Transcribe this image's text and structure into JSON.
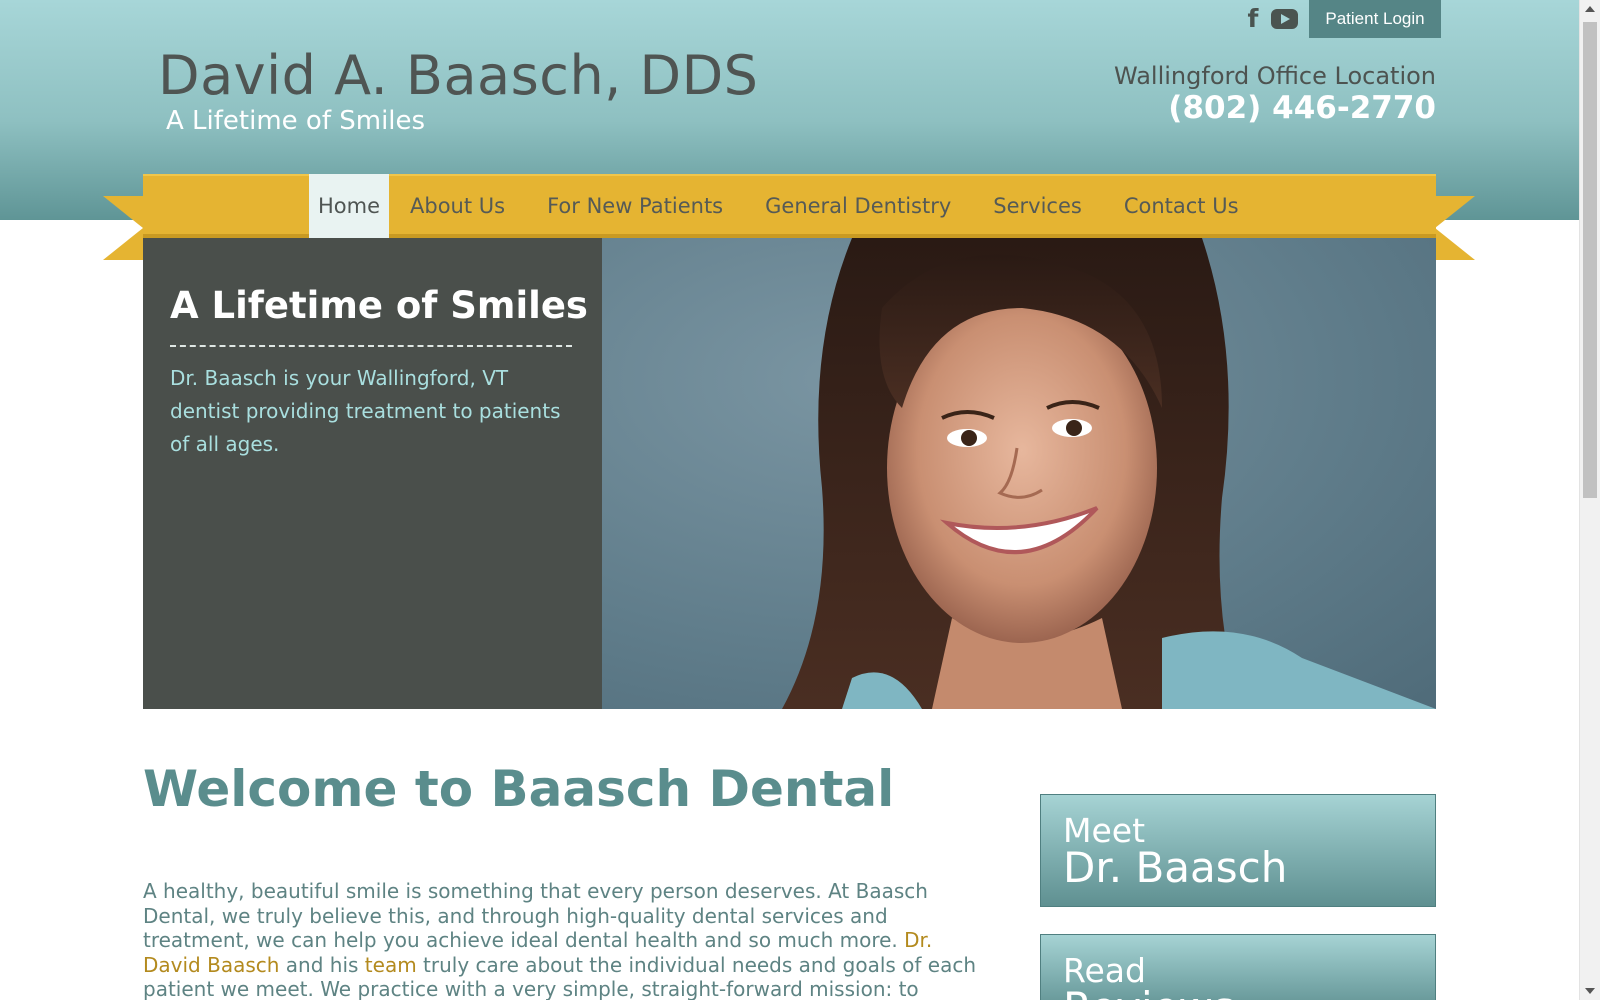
{
  "header": {
    "site_title": "David A. Baasch, DDS",
    "tagline": "A Lifetime of Smiles",
    "office_location": "Wallingford Office Location",
    "phone": "(802) 446-2770",
    "patient_login": "Patient Login",
    "social": [
      "facebook-icon",
      "youtube-icon"
    ],
    "facebook_glyph": "f"
  },
  "nav": {
    "items": [
      {
        "label": "Home",
        "active": true
      },
      {
        "label": "About Us"
      },
      {
        "label": "For New Patients"
      },
      {
        "label": "General Dentistry"
      },
      {
        "label": "Services"
      },
      {
        "label": "Contact Us"
      }
    ]
  },
  "hero": {
    "title": "A Lifetime of Smiles",
    "text": "Dr. Baasch is your Wallingford, VT dentist providing treatment to patients of all ages."
  },
  "main": {
    "welcome_title": "Welcome to Baasch Dental",
    "intro": {
      "p1": "A healthy, beautiful smile is something that every person deserves. At Baasch Dental, we truly believe this, and through high-quality dental services and treatment, we can help you achieve ideal dental health and so much more. ",
      "link_doctor": "Dr. David Baasch",
      "p2": " and his ",
      "link_team": "team",
      "p3": " truly care about the individual needs and goals of each patient we meet. We practice with a very simple, straight-forward mission: to"
    }
  },
  "sidebar": {
    "meet": {
      "small": "Meet",
      "big": "Dr. Baasch"
    },
    "read": {
      "small": "Read",
      "big": "Reviews"
    }
  },
  "colors": {
    "header_teal": "#a7d6d8",
    "ribbon_gold": "#e5b432",
    "hero_panel": "#4a4f4b",
    "hero_text": "#a9dfdf",
    "welcome_teal": "#5a8d8d",
    "link_gold": "#b38a1e"
  }
}
